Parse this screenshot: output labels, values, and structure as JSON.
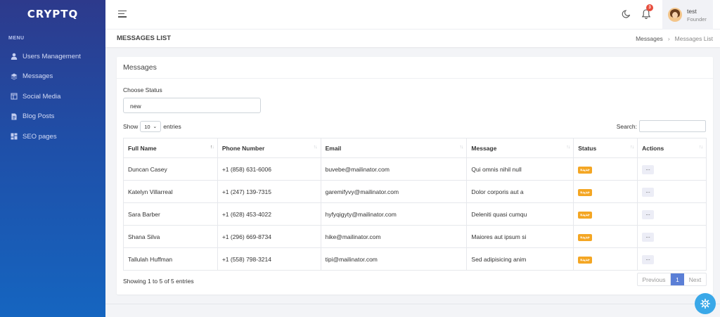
{
  "app": {
    "brand": "CRYPTQ"
  },
  "sidebar": {
    "menu_label": "MENU",
    "items": [
      {
        "label": "Users Management",
        "icon": "user-icon"
      },
      {
        "label": "Messages",
        "icon": "layers-icon"
      },
      {
        "label": "Social Media",
        "icon": "layout-icon"
      },
      {
        "label": "Blog Posts",
        "icon": "document-icon"
      },
      {
        "label": "SEO pages",
        "icon": "grid-icon"
      }
    ]
  },
  "topbar": {
    "notification_count": "3",
    "user": {
      "name": "test",
      "role": "Founder"
    }
  },
  "page": {
    "title": "MESSAGES LIST",
    "breadcrumb": {
      "parent": "Messages",
      "separator": "›",
      "current": "Messages List"
    }
  },
  "card": {
    "title": "Messages",
    "status_label": "Choose Status",
    "status_value": "new",
    "show_label": "Show",
    "entries_value": "10",
    "entries_label": "entries",
    "search_label": "Search:"
  },
  "table": {
    "headers": [
      "Full Name",
      "Phone Number",
      "Email",
      "Message",
      "Status",
      "Actions"
    ],
    "rows": [
      {
        "name": "Duncan Casey",
        "phone": "+1 (858) 631-6006",
        "email": "buvebe@mailinator.com",
        "message": "Qui omnis nihil null",
        "status": "جديدة",
        "action": "..."
      },
      {
        "name": "Katelyn Villarreal",
        "phone": "+1 (247) 139-7315",
        "email": "garemifyvy@mailinator.com",
        "message": "Dolor corporis aut a",
        "status": "جديدة",
        "action": "..."
      },
      {
        "name": "Sara Barber",
        "phone": "+1 (628) 453-4022",
        "email": "hyfyqigyty@mailinator.com",
        "message": "Deleniti quasi cumqu",
        "status": "جديدة",
        "action": "..."
      },
      {
        "name": "Shana Silva",
        "phone": "+1 (296) 669-8734",
        "email": "hike@mailinator.com",
        "message": "Maiores aut ipsum si",
        "status": "جديدة",
        "action": "..."
      },
      {
        "name": "Tallulah Huffman",
        "phone": "+1 (558) 798-3214",
        "email": "tipi@mailinator.com",
        "message": "Sed adipisicing anim",
        "status": "جديدة",
        "action": "..."
      }
    ],
    "info": "Showing 1 to 5 of 5 entries"
  },
  "pagination": {
    "previous": "Previous",
    "page": "1",
    "next": "Next"
  },
  "colors": {
    "accent": "#5b7fd6",
    "badge": "#f4a623",
    "notification": "#e74c3c",
    "fab": "#3aa8e8"
  }
}
